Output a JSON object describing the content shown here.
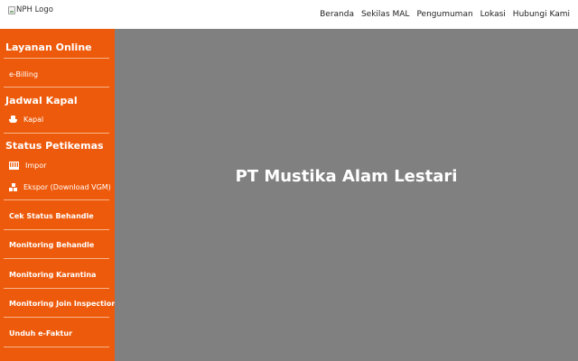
{
  "header": {
    "logo_alt": "NPH Logo",
    "nav": [
      "Beranda",
      "Sekilas MAL",
      "Pengumuman",
      "Lokasi",
      "Hubungi Kami"
    ]
  },
  "sidebar": {
    "layanan_title": "Layanan Online",
    "ebilling": "e-Billing",
    "jadwal_title": "Jadwal Kapal",
    "kapal": "Kapal",
    "status_title": "Status Petikemas",
    "impor": "Impor",
    "ekspor": "Ekspor (Download VGM)",
    "cek_behandle": "Cek Status Behandle",
    "mon_behandle": "Monitoring Behandle",
    "mon_karantina": "Monitoring Karantina",
    "mon_join": "Monitoring Join Inspection",
    "unduh_faktur": "Unduh e-Faktur"
  },
  "main": {
    "title": "PT Mustika Alam Lestari"
  },
  "colors": {
    "sidebar_bg": "#ee5a0b",
    "main_bg": "#808080"
  },
  "icons": [
    "ship-icon",
    "container-crane-icon",
    "boxes-icon"
  ]
}
